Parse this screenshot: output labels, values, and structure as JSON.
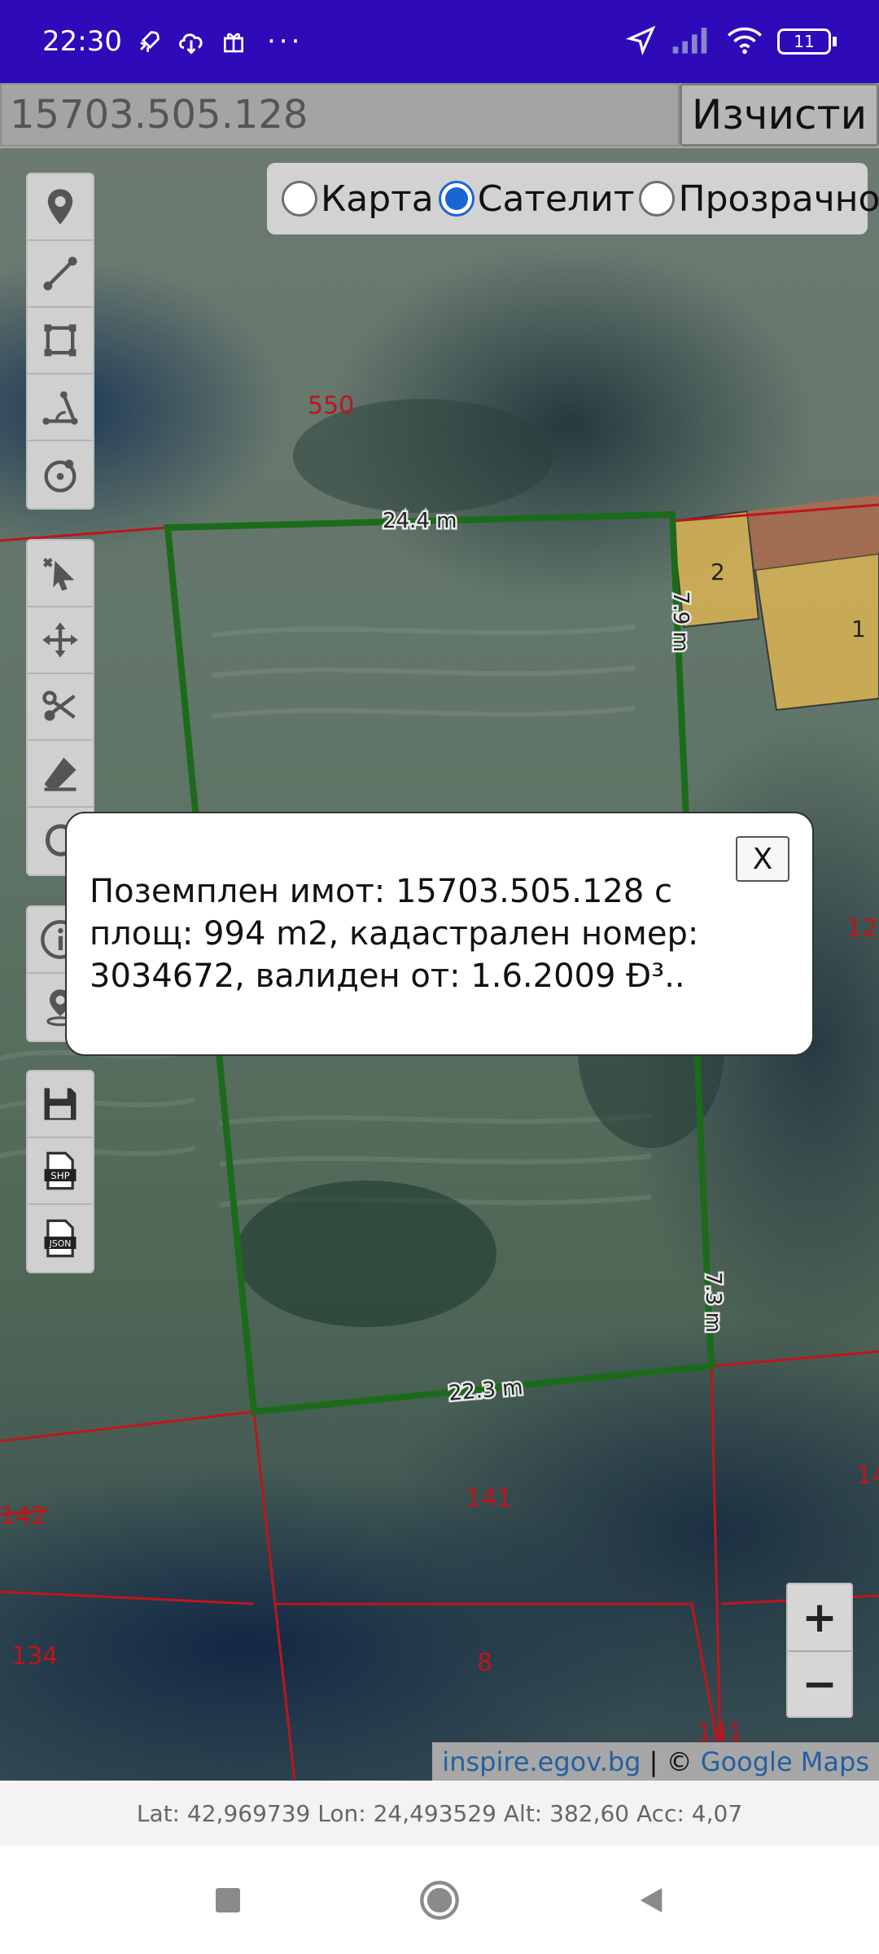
{
  "status_bar": {
    "time": "22:30",
    "overflow": "···",
    "battery": "11",
    "icons": [
      "rocket-icon",
      "cloud-download-icon",
      "gift-icon",
      "location-arrow-icon",
      "signal-icon",
      "wifi-icon",
      "battery-icon"
    ]
  },
  "search": {
    "value": "15703.505.128",
    "clear_label": "Изчисти"
  },
  "layers": {
    "options": [
      {
        "label": "Карта",
        "checked": false
      },
      {
        "label": "Сателит",
        "checked": true
      },
      {
        "label": "Прозрачно",
        "checked": false
      }
    ]
  },
  "map": {
    "parcel_labels": [
      "550",
      "2",
      "1",
      "12",
      "142",
      "141",
      "14",
      "134",
      "8",
      "141"
    ],
    "measurements": [
      "24.4 m",
      "7.9 m",
      "7.3 m",
      "22.3 m"
    ],
    "colors": {
      "parcel_outline": "#1b6b1b",
      "cadastre_lines": "#c0141c",
      "building": "#d6b25a"
    }
  },
  "toolbar": {
    "group1": [
      "marker-icon",
      "line-icon",
      "polygon-icon",
      "angle-icon",
      "circle-icon"
    ],
    "group2": [
      "pointer-edit-icon",
      "move-icon",
      "scissors-icon",
      "eraser-icon",
      "undo-icon"
    ],
    "group3": [
      "info-icon",
      "person-location-icon"
    ],
    "group4_labels": {
      "shp": "SHP",
      "json": "JSON"
    }
  },
  "zoom": {
    "in": "+",
    "out": "−"
  },
  "attribution": {
    "source": "inspire.egov.bg",
    "separator": " | © ",
    "maps": "Google Maps"
  },
  "popup": {
    "close": "X",
    "text": "Поземплен имот: 15703.505.128 с площ: 994 m2, кадастрален номер: 3034672, валиден от: 1.6.2009 Ð³.."
  },
  "coords": "Lat: 42,969739 Lon: 24,493529 Alt: 382,60 Acc: 4,07",
  "nav": {
    "icons": [
      "recents-square-icon",
      "home-circle-icon",
      "back-triangle-icon"
    ]
  }
}
